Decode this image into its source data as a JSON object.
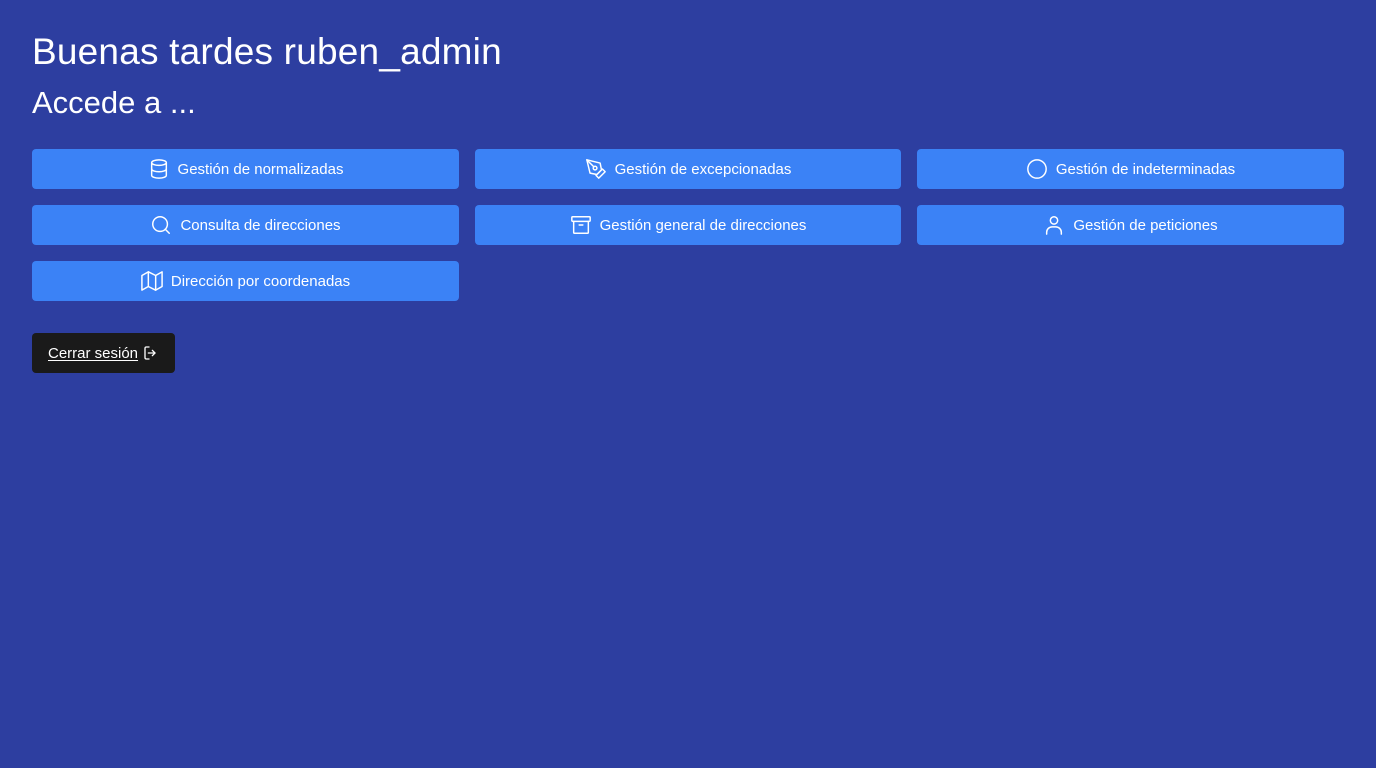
{
  "header": {
    "greeting": "Buenas tardes ruben_admin",
    "subtitle": "Accede a ..."
  },
  "menu": {
    "items": [
      {
        "label": "Gestión de normalizadas",
        "icon": "database-icon"
      },
      {
        "label": "Gestión de excepcionadas",
        "icon": "pen-tool-icon"
      },
      {
        "label": "Gestión de indeterminadas",
        "icon": "circle-icon"
      },
      {
        "label": "Consulta de direcciones",
        "icon": "search-icon"
      },
      {
        "label": "Gestión general de direcciones",
        "icon": "archive-icon"
      },
      {
        "label": "Gestión de peticiones",
        "icon": "user-icon"
      },
      {
        "label": "Dirección por coordenadas",
        "icon": "map-icon"
      }
    ]
  },
  "logout": {
    "label": "Cerrar sesión",
    "icon": "logout-icon"
  },
  "colors": {
    "background": "#2d3ea0",
    "button": "#3b82f6",
    "logout_button": "#1a1a1a",
    "text": "#ffffff"
  }
}
